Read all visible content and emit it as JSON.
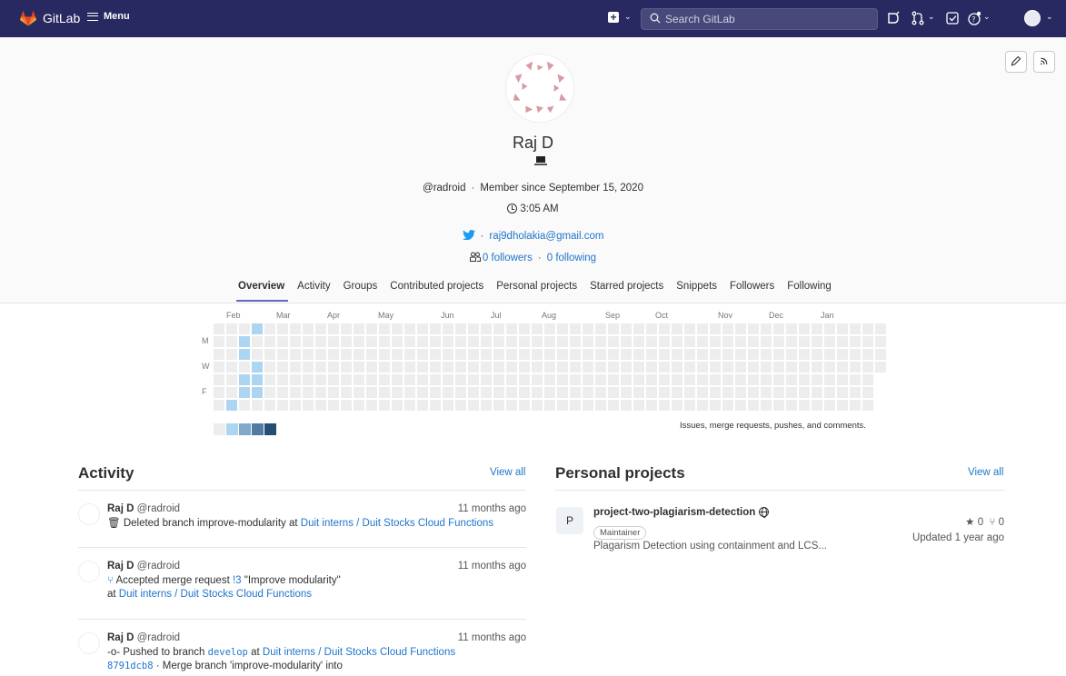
{
  "topbar": {
    "brand": "GitLab",
    "menu_label": "Menu",
    "search_placeholder": "Search GitLab"
  },
  "profile": {
    "name": "Raj D",
    "username": "@radroid",
    "member_since": "Member since September 15, 2020",
    "local_time": "3:05 AM",
    "email": "raj9dholakia@gmail.com",
    "followers": "0 followers",
    "following": "0 following"
  },
  "tabs": [
    {
      "label": "Overview",
      "active": true
    },
    {
      "label": "Activity"
    },
    {
      "label": "Groups"
    },
    {
      "label": "Contributed projects"
    },
    {
      "label": "Personal projects"
    },
    {
      "label": "Starred projects"
    },
    {
      "label": "Snippets"
    },
    {
      "label": "Followers"
    },
    {
      "label": "Following"
    }
  ],
  "calendar": {
    "months": [
      "Feb",
      "Mar",
      "Apr",
      "May",
      "Jun",
      "Jul",
      "Aug",
      "Sep",
      "Oct",
      "Nov",
      "Dec",
      "Jan"
    ],
    "day_labels": [
      "M",
      "W",
      "F"
    ],
    "note": "Issues, merge requests, pushes, and comments.",
    "colors": [
      "#ededed",
      "#acd5f2",
      "#7fa8c9",
      "#527ba0",
      "#254e77"
    ]
  },
  "activity": {
    "title": "Activity",
    "view_all": "View all",
    "items": [
      {
        "author": "Raj D",
        "handle": "@radroid",
        "time": "11 months ago",
        "action": "Deleted branch improve-modularity at",
        "project": "Duit interns / Duit Stocks Cloud Functions"
      },
      {
        "author": "Raj D",
        "handle": "@radroid",
        "time": "11 months ago",
        "action": "Accepted merge request",
        "mr": "!3",
        "mr_title": "\"Improve modularity\"",
        "at": "at",
        "project": "Duit interns / Duit Stocks Cloud Functions"
      },
      {
        "author": "Raj D",
        "handle": "@radroid",
        "time": "11 months ago",
        "action": "Pushed to branch",
        "branch": "develop",
        "at": "at",
        "project": "Duit interns / Duit Stocks Cloud Functions",
        "commit": "8791dcb8",
        "commit_msg": "· Merge branch 'improve-modularity' into"
      }
    ]
  },
  "personal_projects": {
    "title": "Personal projects",
    "view_all": "View all",
    "items": [
      {
        "initial": "P",
        "name": "project-two-plagiarism-detection",
        "role": "Maintainer",
        "description": "Plagarism Detection using containment and LCS...",
        "stars": "0",
        "forks": "0",
        "updated": "Updated 1 year ago"
      }
    ]
  }
}
